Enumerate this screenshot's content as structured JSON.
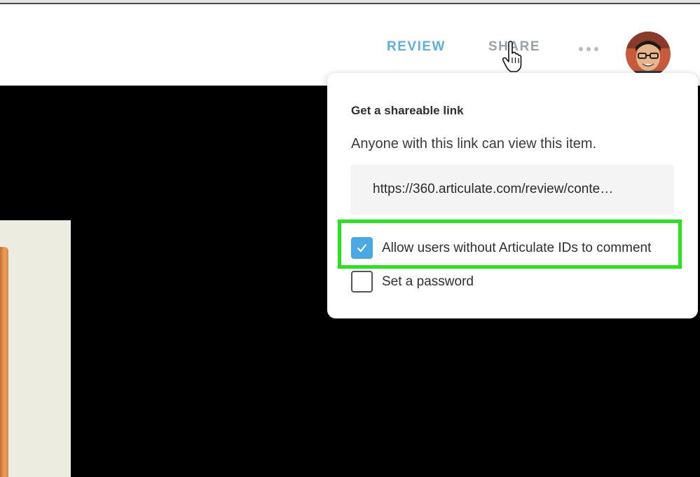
{
  "header": {
    "nav": {
      "review_label": "REVIEW",
      "share_label": "SHARE"
    },
    "more_icon": "ellipsis-icon",
    "avatar_icon": "user-avatar"
  },
  "share_popup": {
    "title": "Get a shareable link",
    "description": "Anyone with this link can view this item.",
    "link_url": "https://360.articulate.com/review/conte…",
    "options": [
      {
        "label": "Allow users without Articulate IDs to comment",
        "checked": true
      },
      {
        "label": "Set a password",
        "checked": false
      }
    ]
  },
  "colors": {
    "accent": "#5cb0dc",
    "checkbox_checked": "#4aa9e4",
    "highlight": "#26e61b",
    "stage": "#000000"
  }
}
